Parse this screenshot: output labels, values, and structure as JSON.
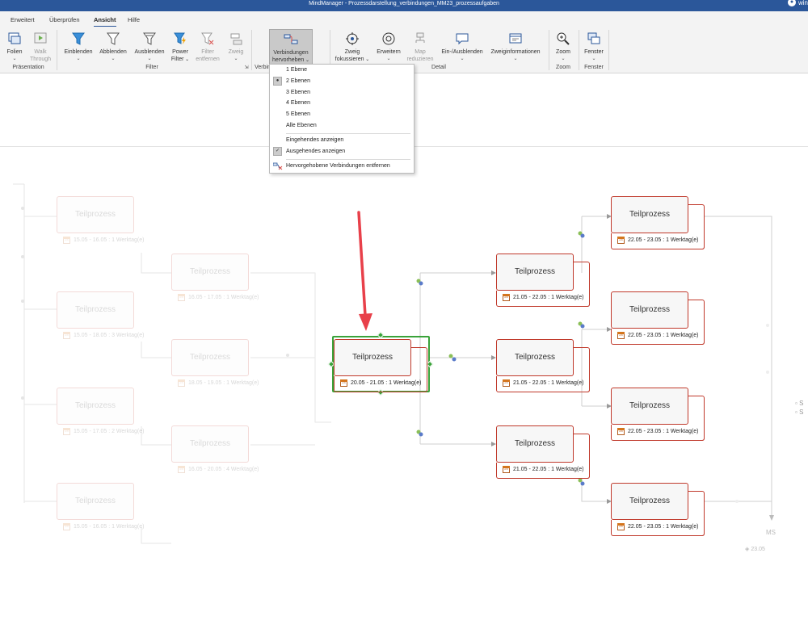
{
  "titlebar": {
    "title": "MindManager - Prozessdarstellung_verbindungen_MM23_prozessaufgaben",
    "user": "win"
  },
  "tabs": [
    {
      "label": "Erweitert"
    },
    {
      "label": "Überprüfen"
    },
    {
      "label": "Ansicht",
      "active": true
    },
    {
      "label": "Hilfe"
    }
  ],
  "ribbon": {
    "folien": {
      "label": "Folien"
    },
    "walk": {
      "label1": "Walk",
      "label2": "Through"
    },
    "einblenden": {
      "label": "Einblenden"
    },
    "abblenden": {
      "label": "Abblenden"
    },
    "ausblenden": {
      "label": "Ausblenden"
    },
    "power": {
      "label1": "Power",
      "label2": "Filter"
    },
    "filterent": {
      "label1": "Filter",
      "label2": "entfernen"
    },
    "zweig": {
      "label": "Zweig"
    },
    "verbindungen": {
      "label1": "Verbindungen",
      "label2": "hervorheben"
    },
    "fokus": {
      "label1": "Zweig",
      "label2": "fokussieren"
    },
    "erweitern": {
      "label": "Erweitern"
    },
    "map": {
      "label1": "Map",
      "label2": "reduzieren"
    },
    "einaus": {
      "label": "Ein-/Ausblenden"
    },
    "zweiginfo": {
      "label": "Zweiginformationen"
    },
    "zoom": {
      "label": "Zoom"
    },
    "fenster": {
      "label": "Fenster"
    },
    "groups": {
      "praesentation": "Präsentation",
      "filter": "Filter",
      "verbin": "Verbin",
      "detail": "Detail",
      "zoom": "Zoom",
      "fenster": "Fenster"
    }
  },
  "dropdown": {
    "levels": [
      {
        "label": "1 Ebene"
      },
      {
        "label": "2 Ebenen",
        "selected": true
      },
      {
        "label": "3 Ebenen"
      },
      {
        "label": "4 Ebenen"
      },
      {
        "label": "5 Ebenen"
      },
      {
        "label": "Alle Ebenen"
      }
    ],
    "incoming": "Eingehendes anzeigen",
    "outgoing": "Ausgehendes anzeigen",
    "remove": "Hervorgehobene Verbindungen entfernen"
  },
  "nodes": {
    "n1": {
      "title": "Teilprozess",
      "info": "15.05 - 16.05 : 1 Werktag(e)"
    },
    "n2": {
      "title": "Teilprozess",
      "info": "15.05 - 18.05 : 3 Werktag(e)"
    },
    "n3": {
      "title": "Teilprozess",
      "info": "15.05 - 17.05 : 2 Werktag(e)"
    },
    "n4": {
      "title": "Teilprozess",
      "info": "15.05 - 16.05 : 1 Werktag(e)"
    },
    "n5": {
      "title": "Teilprozess",
      "info": "16.05 - 17.05 : 1 Werktag(e)"
    },
    "n6": {
      "title": "Teilprozess",
      "info": "18.05 - 19.05 : 1 Werktag(e)"
    },
    "n7": {
      "title": "Teilprozess",
      "info": "16.05 - 20.05 : 4 Werktag(e)"
    },
    "center": {
      "title": "Teilprozess",
      "info": "20.05 - 21.05 : 1 Werktag(e)"
    },
    "m1": {
      "title": "Teilprozess",
      "info": "21.05 - 22.05 : 1 Werktag(e)"
    },
    "m2": {
      "title": "Teilprozess",
      "info": "21.05 - 22.05 : 1 Werktag(e)"
    },
    "m3": {
      "title": "Teilprozess",
      "info": "21.05 - 22.05 : 1 Werktag(e)"
    },
    "r1": {
      "title": "Teilprozess",
      "info": "22.05 - 23.05 : 1 Werktag(e)"
    },
    "r2": {
      "title": "Teilprozess",
      "info": "22.05 - 23.05 : 1 Werktag(e)"
    },
    "r3": {
      "title": "Teilprozess",
      "info": "22.05 - 23.05 : 1 Werktag(e)"
    },
    "r4": {
      "title": "Teilprozess",
      "info": "22.05 - 23.05 : 1 Werktag(e)"
    }
  },
  "milestone": {
    "label": "MS",
    "date": "23.05"
  },
  "sidenotes": [
    "S",
    "S"
  ],
  "colors": {
    "accent": "#2b579a",
    "nodeBorder": "#c0392b",
    "selection": "#3aa33a",
    "arrow": "#e8404a"
  }
}
